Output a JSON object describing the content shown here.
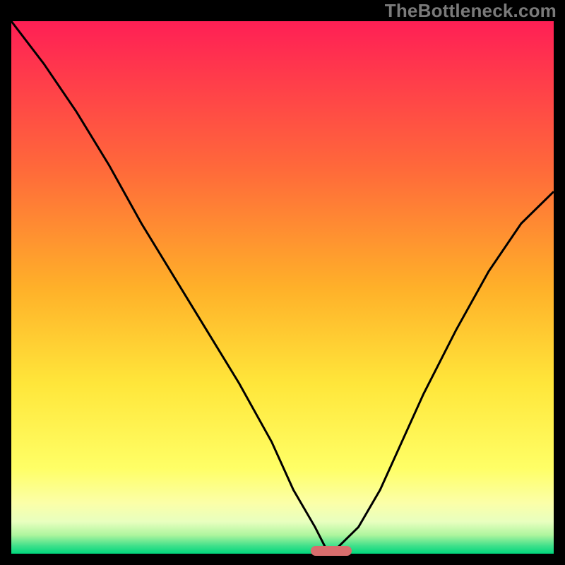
{
  "watermark": "TheBottleneck.com",
  "chart_data": {
    "type": "line",
    "title": "",
    "xlabel": "",
    "ylabel": "",
    "xlim": [
      0,
      100
    ],
    "ylim": [
      0,
      100
    ],
    "grid": false,
    "legend": false,
    "series": [
      {
        "name": "bottleneck-curve",
        "x": [
          0,
          6,
          12,
          18,
          24,
          30,
          36,
          42,
          48,
          52,
          56,
          58,
          60,
          64,
          68,
          72,
          76,
          82,
          88,
          94,
          100
        ],
        "values": [
          100,
          92,
          83,
          73,
          62,
          52,
          42,
          32,
          21,
          12,
          5,
          1,
          1,
          5,
          12,
          21,
          30,
          42,
          53,
          62,
          68
        ]
      }
    ],
    "optimal_point": {
      "x": 59,
      "y": 0.5
    },
    "gradient_stops": [
      {
        "offset": 0,
        "color": "#ff1f55"
      },
      {
        "offset": 0.28,
        "color": "#ff6a3a"
      },
      {
        "offset": 0.5,
        "color": "#ffb029"
      },
      {
        "offset": 0.68,
        "color": "#ffe63a"
      },
      {
        "offset": 0.84,
        "color": "#ffff66"
      },
      {
        "offset": 0.905,
        "color": "#fbffa8"
      },
      {
        "offset": 0.94,
        "color": "#e8ffbf"
      },
      {
        "offset": 0.965,
        "color": "#aef59e"
      },
      {
        "offset": 0.985,
        "color": "#41e08b"
      },
      {
        "offset": 1.0,
        "color": "#00d77d"
      }
    ],
    "colors": {
      "curve": "#000000",
      "curve_width": 3,
      "marker": "#d86d6d",
      "background": "#000000"
    }
  }
}
